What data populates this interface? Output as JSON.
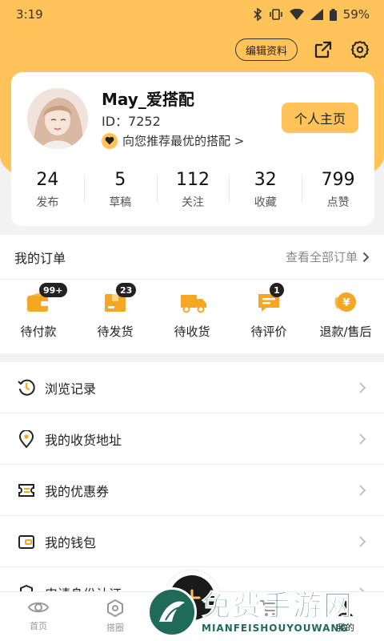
{
  "status": {
    "time": "3:19",
    "battery": "59%"
  },
  "header": {
    "edit_profile": "编辑资料"
  },
  "profile": {
    "username": "May_爱搭配",
    "user_id": "ID：7252",
    "recommend": "向您推荐最优的搭配 >",
    "homepage_button": "个人主页"
  },
  "stats": [
    {
      "value": "24",
      "label": "发布"
    },
    {
      "value": "5",
      "label": "草稿"
    },
    {
      "value": "112",
      "label": "关注"
    },
    {
      "value": "32",
      "label": "收藏"
    },
    {
      "value": "799",
      "label": "点赞"
    }
  ],
  "orders": {
    "title": "我的订单",
    "view_all": "查看全部订单",
    "items": [
      {
        "label": "待付款",
        "badge": "99+",
        "icon": "wallet-icon"
      },
      {
        "label": "待发货",
        "badge": "23",
        "icon": "package-icon"
      },
      {
        "label": "待收货",
        "badge": "",
        "icon": "truck-icon"
      },
      {
        "label": "待评价",
        "badge": "1",
        "icon": "comment-icon"
      },
      {
        "label": "退款/售后",
        "badge": "",
        "icon": "refund-icon"
      }
    ]
  },
  "menu": [
    {
      "label": "浏览记录",
      "icon": "history-icon"
    },
    {
      "label": "我的收货地址",
      "icon": "location-icon"
    },
    {
      "label": "我的优惠券",
      "icon": "coupon-icon"
    },
    {
      "label": "我的钱包",
      "icon": "wallet-icon"
    },
    {
      "label": "申请身份认证",
      "icon": "shield-icon"
    }
  ],
  "tabs": [
    {
      "label": "首页",
      "icon": "eye-icon"
    },
    {
      "label": "搭圈",
      "icon": "hexagon-icon"
    },
    {
      "label": "",
      "icon": "center-icon"
    },
    {
      "label": "",
      "icon": "cart-icon"
    },
    {
      "label": "我的",
      "icon": "user-icon"
    }
  ],
  "watermark": {
    "cn": "免费手游网",
    "en": "MIANFEISHOUYOUWANG"
  },
  "colors": {
    "accent": "#ffc35a",
    "orange": "#f5a623",
    "background": "#f2f2f2"
  }
}
